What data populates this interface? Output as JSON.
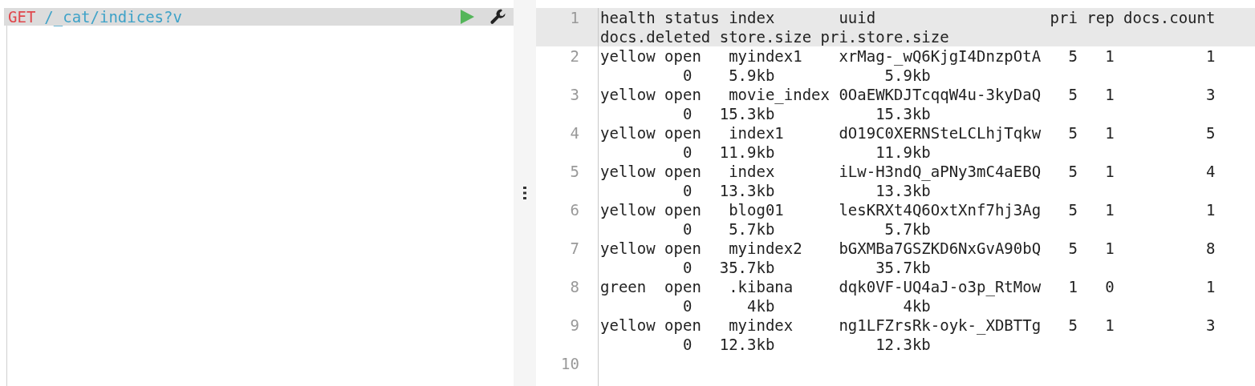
{
  "request": {
    "method": "GET",
    "path": "/_cat/indices?v",
    "active": true
  },
  "output": {
    "lines": [
      {
        "number": "1",
        "active": true,
        "rows": [
          "health status index       uuid                   pri rep docs.count",
          "docs.deleted store.size pri.store.size"
        ]
      },
      {
        "number": "2",
        "active": false,
        "rows": [
          "yellow open   myindex1    xrMag-_wQ6KjgI4DnzpOtA   5   1          1",
          "         0    5.9kb            5.9kb"
        ]
      },
      {
        "number": "3",
        "active": false,
        "rows": [
          "yellow open   movie_index 0OaEWKDJTcqqW4u-3kyDaQ   5   1          3",
          "         0   15.3kb           15.3kb"
        ]
      },
      {
        "number": "4",
        "active": false,
        "rows": [
          "yellow open   index1      dO19C0XERNSteLCLhjTqkw   5   1          5",
          "         0   11.9kb           11.9kb"
        ]
      },
      {
        "number": "5",
        "active": false,
        "rows": [
          "yellow open   index       iLw-H3ndQ_aPNy3mC4aEBQ   5   1          4",
          "         0   13.3kb           13.3kb"
        ]
      },
      {
        "number": "6",
        "active": false,
        "rows": [
          "yellow open   blog01      lesKRXt4Q6OxtXnf7hj3Ag   5   1          1",
          "         0    5.7kb            5.7kb"
        ]
      },
      {
        "number": "7",
        "active": false,
        "rows": [
          "yellow open   myindex2    bGXMBa7GSZKD6NxGvA90bQ   5   1          8",
          "         0   35.7kb           35.7kb"
        ]
      },
      {
        "number": "8",
        "active": false,
        "rows": [
          "green  open   .kibana     dqk0VF-UQ4aJ-o3p_RtMow   1   0          1",
          "         0      4kb              4kb"
        ]
      },
      {
        "number": "9",
        "active": false,
        "rows": [
          "yellow open   myindex     ng1LFZrsRk-oyk-_XDBTTg   5   1          3",
          "         0   12.3kb           12.3kb"
        ]
      },
      {
        "number": "10",
        "active": false
      }
    ]
  }
}
